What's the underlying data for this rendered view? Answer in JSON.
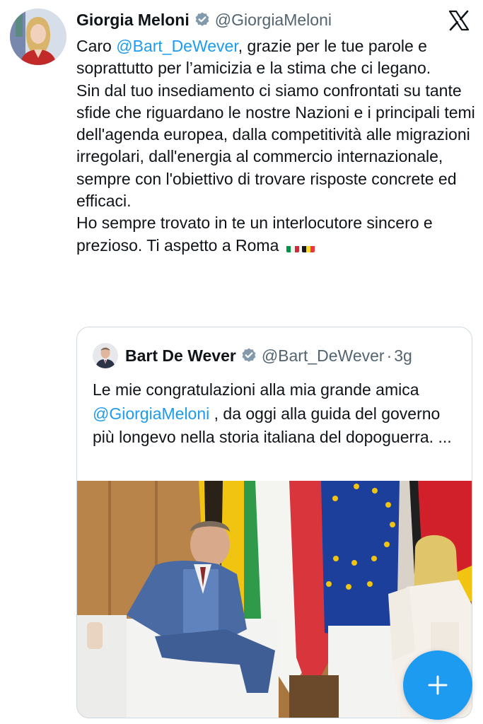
{
  "author": {
    "name": "Giorgia Meloni",
    "handle": "@GiorgiaMeloni"
  },
  "tweet": {
    "segments": [
      {
        "text": "Caro ",
        "type": "text"
      },
      {
        "text": "@Bart_DeWever",
        "type": "mention"
      },
      {
        "text": ", grazie per le tue parole e soprattutto per l’amicizia e la stima che ci legano.\nSin dal tuo insediamento ci siamo confrontati su tante sfide che riguardano le nostre Nazioni e i principali temi dell'agenda europea, dalla competitività alle migrazioni irregolari, dall'energia al commercio internazionale, sempre con l'obiettivo di trovare risposte concrete ed efficaci.\nHo sempre trovato in te un interlocutore sincero e prezioso. Ti aspetto a Roma ",
        "type": "text"
      }
    ],
    "flag_icons": [
      "italy-flag-icon",
      "belgium-flag-icon"
    ]
  },
  "quoted": {
    "name": "Bart De Wever",
    "handle": "@Bart_DeWever",
    "separator": "·",
    "time": "3g",
    "segments": [
      {
        "text": "Le mie congratulazioni alla mia grande amica ",
        "type": "text"
      },
      {
        "text": "@GiorgiaMeloni",
        "type": "mention"
      },
      {
        "text": " , da oggi alla guida del governo più longevo nella storia italiana del dopoguerra. ...",
        "type": "text"
      }
    ]
  },
  "fab": {
    "icon": "plus-icon"
  },
  "colors": {
    "link": "#1d9bf0",
    "secondary_text": "#536471",
    "fab": "#1d9bf0"
  }
}
